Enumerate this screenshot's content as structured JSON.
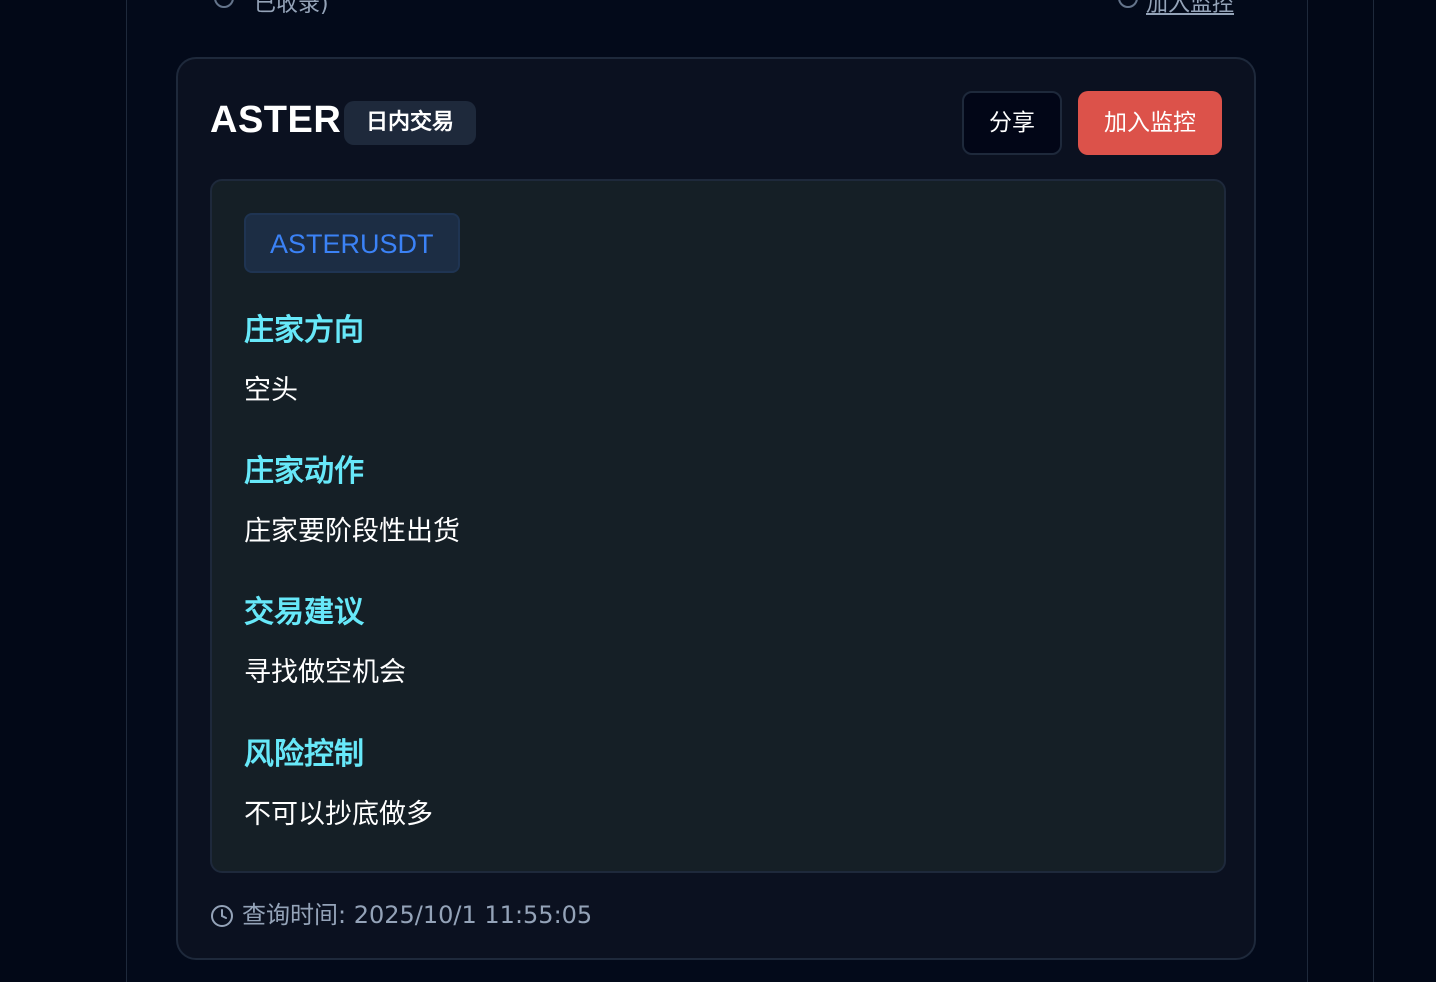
{
  "top_remnant": {
    "left_text": "已收录)",
    "right_text": "加入监控"
  },
  "card": {
    "symbol": "ASTER",
    "tag": "日内交易",
    "share_label": "分享",
    "monitor_label": "加入监控",
    "pair": "ASTERUSDT",
    "sections": [
      {
        "title": "庄家方向",
        "body": "空头"
      },
      {
        "title": "庄家动作",
        "body": "庄家要阶段性出货"
      },
      {
        "title": "交易建议",
        "body": "寻找做空机会"
      },
      {
        "title": "风险控制",
        "body": "不可以抄底做多"
      }
    ],
    "query_time_label": "查询时间: 2025/10/1 11:55:05"
  },
  "colors": {
    "page_bg": "#020817",
    "card_bg": "#0b1120",
    "content_bg": "#151f26",
    "section_title": "#67e8f9",
    "pair_text": "#3b82f6",
    "monitor_button": "#dc524a"
  },
  "icons": {
    "footer": "clock-icon"
  }
}
